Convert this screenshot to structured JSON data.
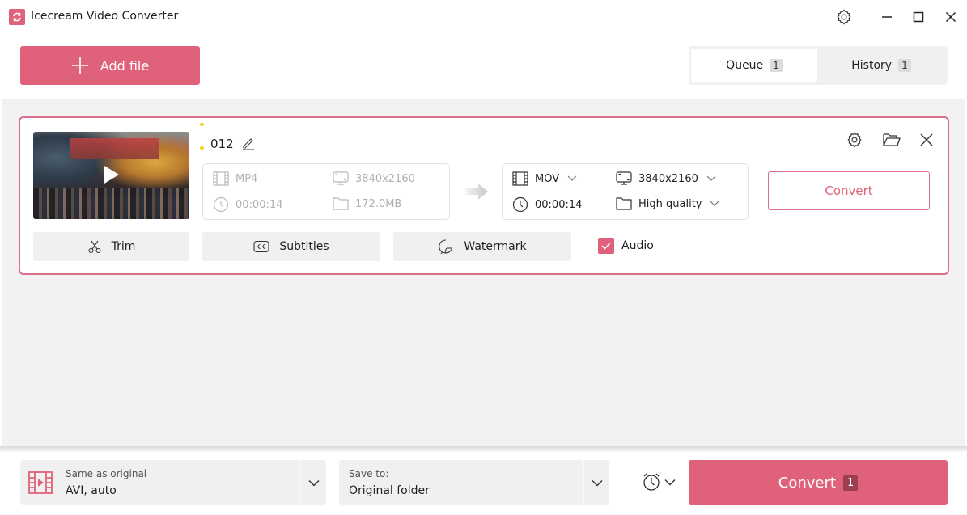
{
  "window": {
    "title": "Icecream Video Converter",
    "controls": {
      "settings": "gear-icon",
      "minimize": "minimize-icon",
      "maximize": "maximize-icon",
      "close": "close-icon"
    }
  },
  "toolbar": {
    "add_file_label": "Add file",
    "tabs": [
      {
        "label": "Queue",
        "count": "1",
        "active": true
      },
      {
        "label": "History",
        "count": "1",
        "active": false
      }
    ]
  },
  "queue": {
    "items": [
      {
        "name": "012",
        "source": {
          "format": "MP4",
          "resolution": "3840x2160",
          "duration": "00:00:14",
          "size": "172.0MB"
        },
        "target": {
          "format": "MOV",
          "resolution": "3840x2160",
          "duration": "00:00:14",
          "quality": "High quality"
        },
        "convert_label": "Convert",
        "actions": {
          "trim": "Trim",
          "subtitles": "Subtitles",
          "watermark": "Watermark"
        },
        "audio": {
          "label": "Audio",
          "checked": true
        }
      }
    ]
  },
  "bottom": {
    "format_select": {
      "caption": "Same as original",
      "value": "AVI, auto"
    },
    "save_select": {
      "caption": "Save to:",
      "value": "Original folder"
    },
    "convert_label": "Convert",
    "convert_count": "1"
  },
  "colors": {
    "accent": "#e0627a",
    "accent_border": "#d8708a",
    "badge_dark": "#9c3f50",
    "panel_bg": "#f2f2f2"
  }
}
